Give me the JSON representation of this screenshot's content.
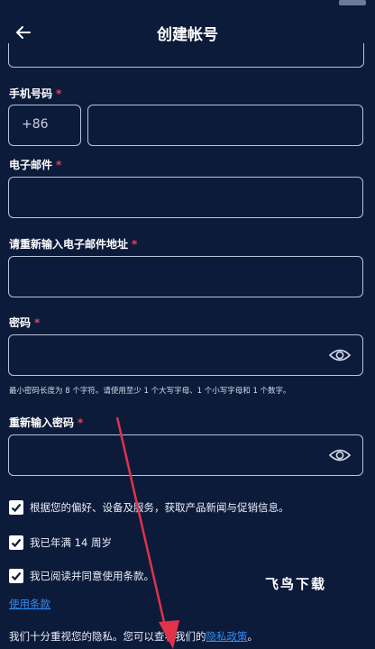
{
  "header": {
    "title": "创建帐号",
    "back_icon": "arrow-left-icon"
  },
  "phone": {
    "label": "手机号码",
    "required_mark": "*",
    "country_code": "+86",
    "value": ""
  },
  "email": {
    "label": "电子邮件",
    "required_mark": "*",
    "value": ""
  },
  "email_confirm": {
    "label": "请重新输入电子邮件地址",
    "required_mark": "*",
    "value": ""
  },
  "password": {
    "label": "密码",
    "required_mark": "*",
    "value": "",
    "toggle_icon": "eye-icon",
    "hint": "最小密码长度为 8 个字符。请使用至少 1 个大写字母、1 个小写字母和 1 个数字。"
  },
  "password_confirm": {
    "label": "重新输入密码",
    "required_mark": "*",
    "value": "",
    "toggle_icon": "eye-icon"
  },
  "checkboxes": [
    {
      "label": "根据您的偏好、设备及服务，获取产品新闻与促销信息。",
      "checked": true
    },
    {
      "label": "我已年满 14 周岁",
      "checked": true
    },
    {
      "label": "我已阅读并同意使用条款。",
      "checked": true
    }
  ],
  "terms_link": "使用条款",
  "privacy": {
    "text": "我们十分重视您的隐私。您可以查看我们的",
    "link": "隐私政策",
    "suffix": "。"
  },
  "watermark": "飞鸟下载",
  "colors": {
    "background": "#0d1b3b",
    "border": "#b9c3d8",
    "required": "#e0445c",
    "link": "#2f8cf0",
    "annotation_arrow": "#e0334a"
  }
}
